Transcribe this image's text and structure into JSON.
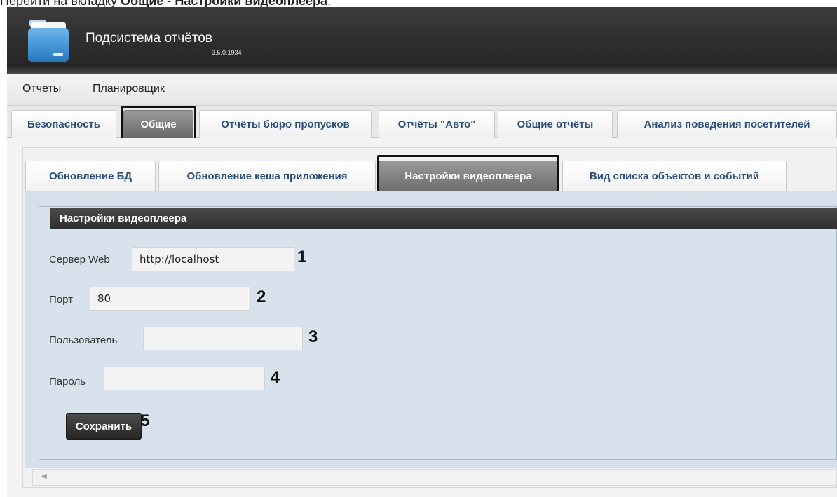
{
  "caption": {
    "prefix": "Перейти на вкладку ",
    "tab_general": "Общие",
    "separator": " - ",
    "tab_player": "Настройки видеоплеера",
    "suffix": "."
  },
  "header": {
    "title": "Подсистема отчётов",
    "version": "3.5.0.1934",
    "logo_icon": "folder-icon"
  },
  "menu": {
    "items": [
      {
        "label": "Отчеты"
      },
      {
        "label": "Планировщик"
      }
    ]
  },
  "main_tabs": [
    {
      "label": "Безопасность",
      "active": false
    },
    {
      "label": "Общие",
      "active": true
    },
    {
      "label": "Отчёты бюро пропусков",
      "active": false
    },
    {
      "label": "Отчёты \"Авто\"",
      "active": false
    },
    {
      "label": "Общие отчёты",
      "active": false
    },
    {
      "label": "Анализ поведения посетителей",
      "active": false
    }
  ],
  "sub_tabs": [
    {
      "label": "Обновление БД",
      "active": false
    },
    {
      "label": "Обновление кеша приложения",
      "active": false
    },
    {
      "label": "Настройки видеоплеера",
      "active": true
    },
    {
      "label": "Вид списка объектов и событий",
      "active": false
    }
  ],
  "settings": {
    "legend": "Настройки видеоплеера",
    "web_server": {
      "label": "Сервер Web",
      "value": "http://localhost",
      "callout": "1"
    },
    "port": {
      "label": "Порт",
      "value": "80",
      "callout": "2"
    },
    "user": {
      "label": "Пользователь",
      "value": "",
      "callout": "3"
    },
    "password": {
      "label": "Пароль",
      "value": "",
      "callout": "4"
    },
    "save": {
      "label": "Сохранить",
      "callout": "5"
    }
  },
  "colors": {
    "header_bg": "#2c2c2c",
    "tab_text": "#2b4f7a",
    "panel_bg": "#d8e2ec",
    "active_tab_bg": "#7a7a7a"
  }
}
